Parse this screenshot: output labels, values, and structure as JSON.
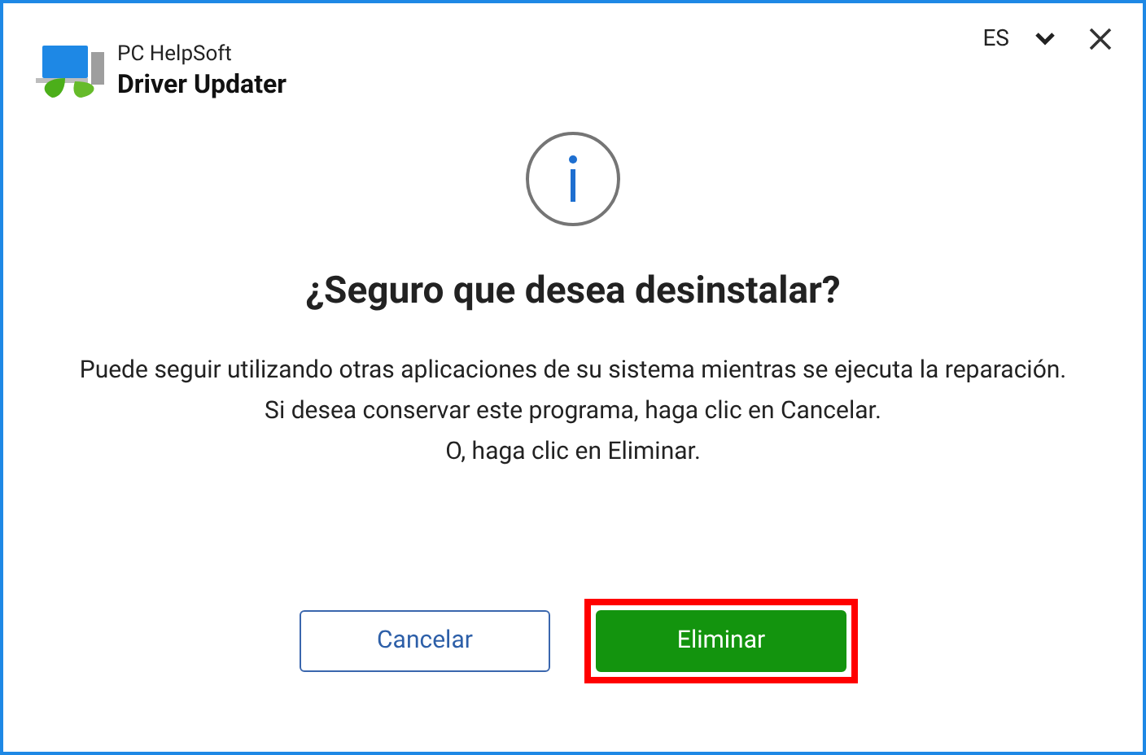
{
  "header": {
    "brand_line1": "PC HelpSoft",
    "brand_line2": "Driver Updater",
    "language": "ES"
  },
  "dialog": {
    "title": "¿Seguro que desea desinstalar?",
    "lines": [
      "Puede seguir utilizando otras aplicaciones de su sistema mientras se ejecuta la reparación.",
      "Si desea conservar este programa, haga clic en Cancelar.",
      "O, haga clic en Eliminar."
    ]
  },
  "buttons": [
    {
      "label": "Cancelar",
      "kind": "secondary",
      "highlighted": false
    },
    {
      "label": "Eliminar",
      "kind": "primary",
      "highlighted": true
    }
  ]
}
